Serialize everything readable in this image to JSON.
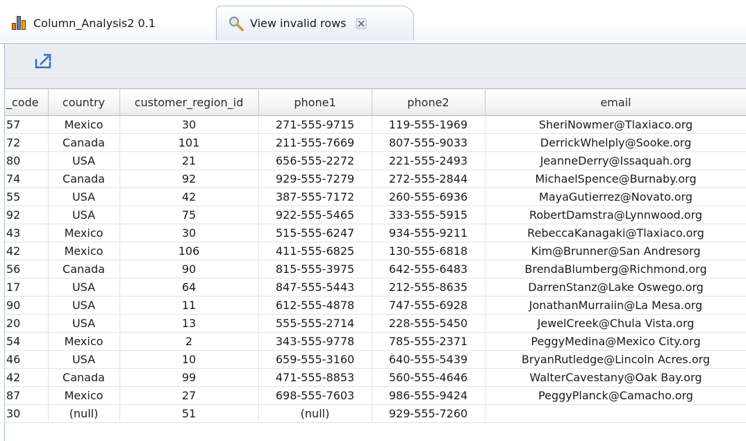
{
  "tabs": [
    {
      "label": "Column_Analysis2 0.1",
      "icon": "bar-chart-icon"
    },
    {
      "label": "View invalid rows",
      "icon": "search-icon",
      "closable": true
    }
  ],
  "toolbar": {
    "export_icon": "export-icon"
  },
  "table": {
    "columns": [
      "_code",
      "country",
      "customer_region_id",
      "phone1",
      "phone2",
      "email"
    ],
    "rows": [
      [
        "57",
        "Mexico",
        "30",
        "271-555-9715",
        "119-555-1969",
        "SheriNowmer@Tlaxiaco.org"
      ],
      [
        "72",
        "Canada",
        "101",
        "211-555-7669",
        "807-555-9033",
        "DerrickWhelply@Sooke.org"
      ],
      [
        "80",
        "USA",
        "21",
        "656-555-2272",
        "221-555-2493",
        "JeanneDerry@Issaquah.org"
      ],
      [
        "74",
        "Canada",
        "92",
        "929-555-7279",
        "272-555-2844",
        "MichaelSpence@Burnaby.org"
      ],
      [
        "55",
        "USA",
        "42",
        "387-555-7172",
        "260-555-6936",
        "MayaGutierrez@Novato.org"
      ],
      [
        "92",
        "USA",
        "75",
        "922-555-5465",
        "333-555-5915",
        "RobertDamstra@Lynnwood.org"
      ],
      [
        "43",
        "Mexico",
        "30",
        "515-555-6247",
        "934-555-9211",
        "RebeccaKanagaki@Tlaxiaco.org"
      ],
      [
        "42",
        "Mexico",
        "106",
        "411-555-6825",
        "130-555-6818",
        "Kim@Brunner@San Andresorg"
      ],
      [
        "56",
        "Canada",
        "90",
        "815-555-3975",
        "642-555-6483",
        "BrendaBlumberg@Richmond.org"
      ],
      [
        "17",
        "USA",
        "64",
        "847-555-5443",
        "212-555-8635",
        "DarrenStanz@Lake Oswego.org"
      ],
      [
        "90",
        "USA",
        "11",
        "612-555-4878",
        "747-555-6928",
        "JonathanMurraiin@La Mesa.org"
      ],
      [
        "20",
        "USA",
        "13",
        "555-555-2714",
        "228-555-5450",
        "JewelCreek@Chula Vista.org"
      ],
      [
        "54",
        "Mexico",
        "2",
        "343-555-9778",
        "785-555-2371",
        "PeggyMedina@Mexico City.org"
      ],
      [
        "46",
        "USA",
        "10",
        "659-555-3160",
        "640-555-5439",
        "BryanRutledge@Lincoln Acres.org"
      ],
      [
        "42",
        "Canada",
        "99",
        "471-555-8853",
        "560-555-4646",
        "WalterCavestany@Oak Bay.org"
      ],
      [
        "87",
        "Mexico",
        "27",
        "698-555-7603",
        "986-555-9424",
        "PeggyPlanck@Camacho.org"
      ],
      [
        "30",
        "(null)",
        "51",
        "(null)",
        "929-555-7260",
        ""
      ]
    ]
  }
}
